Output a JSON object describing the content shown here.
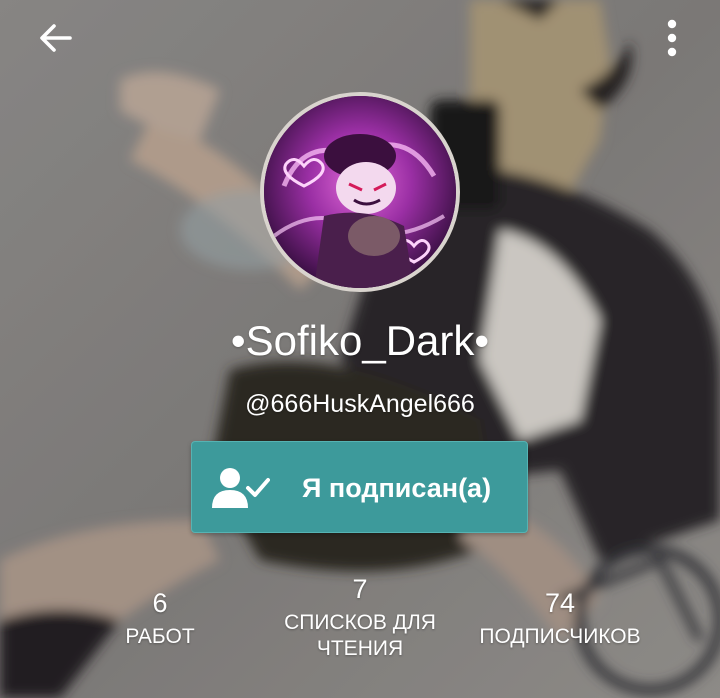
{
  "header": {
    "back_icon": "arrow-left-icon",
    "menu_icon": "vertical-dots-icon"
  },
  "profile": {
    "display_name": "•Sofiko_Dark•",
    "username": "@666HuskAngel666",
    "avatar": "avatar-image"
  },
  "follow_button": {
    "label": "Я подписан(а)",
    "icon": "user-check-icon",
    "color": "#3d9a9b"
  },
  "stats": {
    "works": {
      "value": "6",
      "label": "РАБОТ"
    },
    "reading_lists": {
      "value": "7",
      "label_line1": "СПИСКОВ ДЛЯ",
      "label_line2": "ЧТЕНИЯ"
    },
    "followers": {
      "value": "74",
      "label": "ПОДПИСЧИКОВ"
    }
  }
}
